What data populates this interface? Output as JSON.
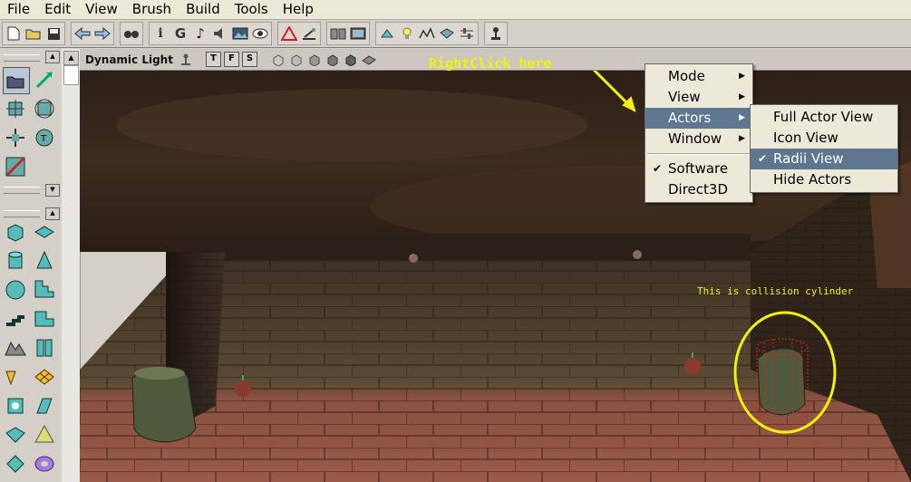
{
  "menubar": [
    "File",
    "Edit",
    "View",
    "Brush",
    "Build",
    "Tools",
    "Help"
  ],
  "toolbar": {
    "icons": [
      "new-file-icon",
      "open-folder-icon",
      "save-icon",
      "undo-icon",
      "redo-icon",
      "search-icon",
      "actor-properties-icon",
      "group-browser-icon",
      "music-browser-icon",
      "sound-browser-icon",
      "texture-browser-icon",
      "mesh-viewer-icon",
      "brush-builder-icon",
      "level-icon",
      "view-actor-icon",
      "light-icon",
      "path-icon",
      "screenshot-icon",
      "settings-icon",
      "play-icon"
    ]
  },
  "viewport": {
    "title": "Dynamic Light",
    "mode_buttons": [
      "T",
      "F",
      "S"
    ],
    "view_mode_icons": [
      "wireframe-icon",
      "zones-icon",
      "flat-icon",
      "dynamic-light-icon",
      "textured-icon",
      "smooth-icon"
    ]
  },
  "annotations": {
    "right_click": "RightClick here",
    "collision": "This is collision cylinder"
  },
  "context_menu": {
    "items": [
      "Mode",
      "View",
      "Actors",
      "Window"
    ],
    "render_items": [
      "Software",
      "Direct3D"
    ],
    "checked_render": "Software",
    "highlighted": "Actors"
  },
  "actors_submenu": {
    "items": [
      "Full Actor View",
      "Icon View",
      "Radii View",
      "Hide Actors"
    ],
    "checked": "Radii View",
    "highlighted": "Radii View"
  },
  "colors": {
    "annotation": "#f2f20a",
    "menu_highlight": "#5f7690",
    "collision_cylinder": "#e02020"
  }
}
